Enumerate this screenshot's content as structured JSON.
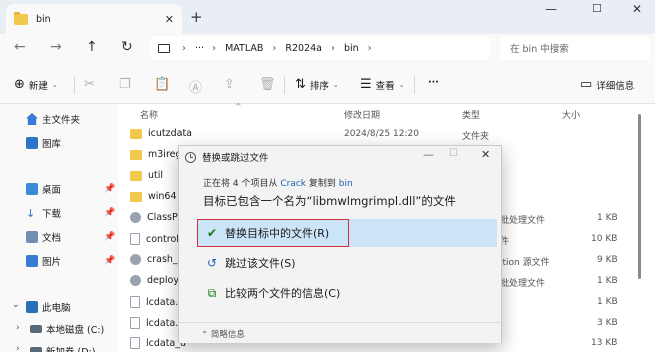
{
  "window": {
    "tab_title": "bin",
    "tab_close": "✕",
    "new_tab": "+",
    "min": "—",
    "max": "☐",
    "close": "✕"
  },
  "nav": {
    "back": "←",
    "forward": "→",
    "up": "↑",
    "refresh": "↻",
    "ellipsis": "···",
    "breadcrumbs": [
      "MATLAB",
      "R2024a",
      "bin"
    ],
    "separator": "›",
    "search_placeholder": "在 bin 中搜索"
  },
  "toolbar": {
    "new_label": "新建",
    "sort_label": "排序",
    "view_label": "查看",
    "more": "···",
    "details_label": "详细信息"
  },
  "sidebar": {
    "items": [
      {
        "label": "主文件夹"
      },
      {
        "label": "图库"
      },
      {
        "label": "桌面"
      },
      {
        "label": "下载"
      },
      {
        "label": "文档"
      },
      {
        "label": "图片"
      },
      {
        "label": "此电脑"
      },
      {
        "label": "本地磁盘 (C:)"
      },
      {
        "label": "新加卷 (D:)"
      }
    ]
  },
  "columns": {
    "name": "名称",
    "date": "修改日期",
    "type": "类型",
    "size": "大小"
  },
  "files": [
    {
      "name": "icutzdata",
      "date": "2024/8/25 12:20",
      "type": "文件夹",
      "size": ""
    },
    {
      "name": "m3iregi",
      "date": "",
      "type": "",
      "size": ""
    },
    {
      "name": "util",
      "date": "",
      "type": "",
      "size": ""
    },
    {
      "name": "win64",
      "date": "",
      "type": "",
      "size": ""
    },
    {
      "name": "ClassPat",
      "date": "",
      "type": "批处理文件",
      "size": "1 KB"
    },
    {
      "name": "controll",
      "date": "",
      "type": "件",
      "size": "10 KB"
    },
    {
      "name": "crash_a",
      "date": "",
      "type": "ition 源文件",
      "size": "9 KB"
    },
    {
      "name": "deployt",
      "date": "",
      "type": "批处理文件",
      "size": "1 KB"
    },
    {
      "name": "lcdata.x",
      "date": "",
      "type": "",
      "size": "1 KB"
    },
    {
      "name": "lcdata.x",
      "date": "",
      "type": "",
      "size": "3 KB"
    },
    {
      "name": "lcdata_u",
      "date": "",
      "type": "",
      "size": "13 KB"
    }
  ],
  "dialog": {
    "title": "替换或跳过文件",
    "info_prefix": "正在将 4 个项目从",
    "info_source": "Crack",
    "info_middle": "复制到",
    "info_dest": "bin",
    "heading": "目标已包含一个名为“libmwlmgrimpl.dll”的文件",
    "replace_label": "替换目标中的文件(R)",
    "skip_label": "跳过该文件(S)",
    "compare_label": "比较两个文件的信息(C)",
    "footer_label": "简略信息",
    "min": "—",
    "max": "☐",
    "close": "✕"
  },
  "colors": {
    "selection": "#cce4f7",
    "highlight_border": "#d13438",
    "folder": "#f2c94c"
  }
}
